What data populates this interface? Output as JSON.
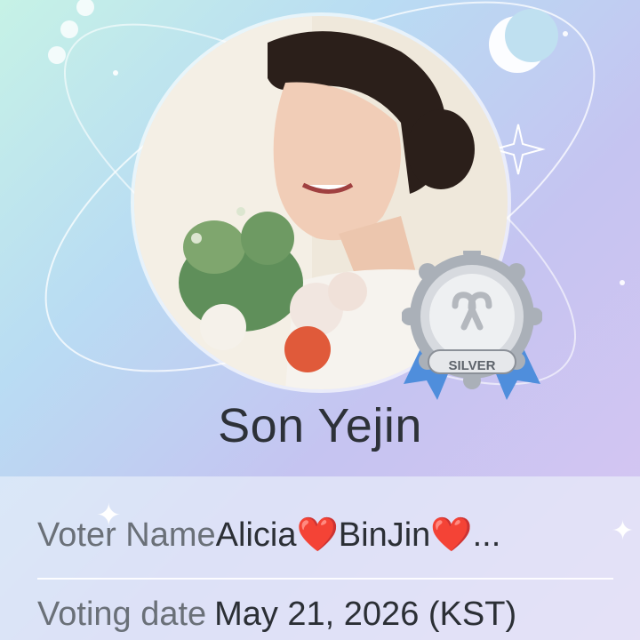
{
  "profile": {
    "name": "Son Yejin",
    "badge_label": "SILVER"
  },
  "vote_info": {
    "voter_name_label": "Voter Name",
    "voter_name_value": "Alicia❤️BinJin❤️...",
    "voting_date_label": "Voting date",
    "voting_date_value": "May 21, 2026 (KST)"
  },
  "colors": {
    "badge_silver": "#c9cdd3",
    "ribbon_blue": "#4f8edc",
    "name_text": "#2d3138"
  },
  "icons": [
    "crescent-moon-icon",
    "sparkle-icon",
    "silver-badge-icon",
    "heart-logo-icon"
  ]
}
